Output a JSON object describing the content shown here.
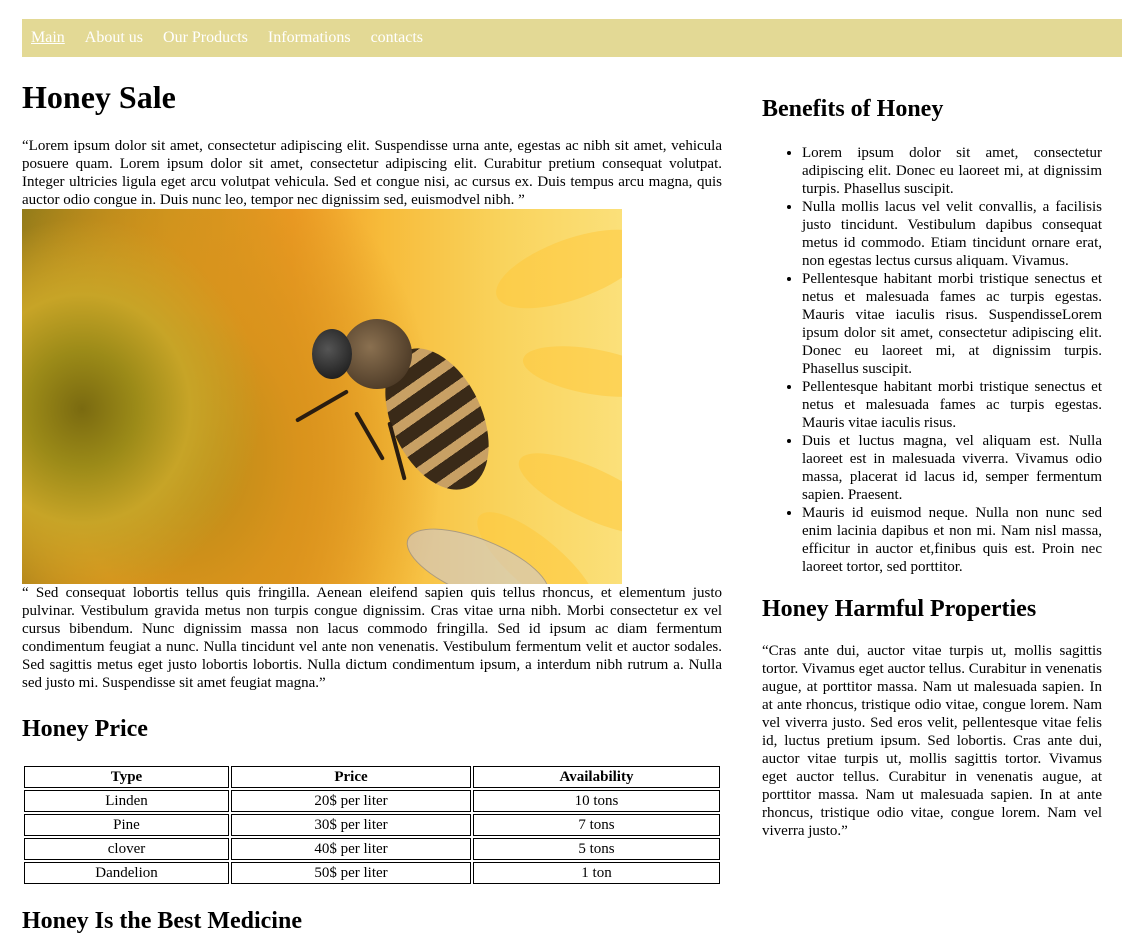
{
  "nav": {
    "items": [
      "Main",
      "About us",
      "Our Products",
      "Informations",
      "contacts"
    ]
  },
  "main": {
    "title": "Honey Sale",
    "intro": "“Lorem ipsum dolor sit amet, consectetur adipiscing elit. Suspendisse urna ante, egestas ac nibh sit amet, vehicula posuere quam. Lorem ipsum dolor sit amet, consectetur adipiscing elit. Curabitur pretium consequat volutpat. Integer ultricies ligula eget arcu volutpat vehicula. Sed et congue nisi, ac cursus ex. Duis tempus arcu magna, quis auctor odio congue in. Duis nunc leo, tempor nec dignissim sed, euismodvel nibh. ”",
    "body": "“ Sed consequat lobortis tellus quis fringilla. Aenean eleifend sapien quis tellus rhoncus, et elementum justo pulvinar. Vestibulum gravida metus non turpis congue dignissim. Cras vitae urna nibh. Morbi consectetur ex vel cursus bibendum. Nunc dignissim massa non lacus commodo fringilla. Sed id ipsum ac diam fermentum condimentum feugiat a nunc. Nulla tincidunt vel ante non venenatis. Vestibulum fermentum velit et auctor sodales. Sed sagittis metus eget justo lobortis lobortis. Nulla dictum condimentum ipsum, a interdum nibh rutrum a. Nulla sed justo mi. Suspendisse sit amet feugiat magna.”",
    "price_title": "Honey Price",
    "price_table": {
      "headers": [
        "Type",
        "Price",
        "Availability"
      ],
      "rows": [
        [
          "Linden",
          "20$ per liter",
          "10 tons"
        ],
        [
          "Pine",
          "30$ per liter",
          "7 tons"
        ],
        [
          "clover",
          "40$ per liter",
          "5 tons"
        ],
        [
          "Dandelion",
          "50$ per liter",
          "1 ton"
        ]
      ]
    },
    "next_title": "Honey Is the Best Medicine"
  },
  "side": {
    "benefits_title": "Benefits of Honey",
    "benefits": [
      "Lorem ipsum dolor sit amet, consectetur adipiscing elit. Donec eu laoreet mi, at dignissim turpis. Phasellus suscipit.",
      "Nulla mollis lacus vel velit convallis, a facilisis justo tincidunt. Vestibulum dapibus consequat metus id commodo. Etiam tincidunt ornare erat, non egestas lectus cursus aliquam. Vivamus.",
      "Pellentesque habitant morbi tristique senectus et netus et malesuada fames ac turpis egestas. Mauris vitae iaculis risus. SuspendisseLorem ipsum dolor sit amet, consectetur adipiscing elit. Donec eu laoreet mi, at dignissim turpis. Phasellus suscipit.",
      "Pellentesque habitant morbi tristique senectus et netus et malesuada fames ac turpis egestas. Mauris vitae iaculis risus.",
      "Duis et luctus magna, vel aliquam est. Nulla laoreet est in malesuada viverra. Vivamus odio massa, placerat id lacus id, semper fermentum sapien. Praesent.",
      "Mauris id euismod neque. Nulla non nunc sed enim lacinia dapibus et non mi. Nam nisl massa, efficitur in auctor et,finibus quis est. Proin nec laoreet tortor, sed porttitor."
    ],
    "harmful_title": "Honey Harmful Properties",
    "harmful_text": "“Cras ante dui, auctor vitae turpis ut, mollis sagittis tortor. Vivamus eget auctor tellus. Curabitur in venenatis augue, at porttitor massa. Nam ut malesuada sapien. In at ante rhoncus, tristique odio vitae, congue lorem. Nam vel viverra justo. Sed eros velit, pellentesque vitae felis id, luctus pretium ipsum. Sed lobortis. Cras ante dui, auctor vitae turpis ut, mollis sagittis tortor. Vivamus eget auctor tellus. Curabitur in venenatis augue, at porttitor massa. Nam ut malesuada sapien. In at ante rhoncus, tristique odio vitae, congue lorem. Nam vel viverra justo.”"
  },
  "colors": {
    "nav_bg": "#e3d995",
    "nav_text": "#ffffff"
  }
}
